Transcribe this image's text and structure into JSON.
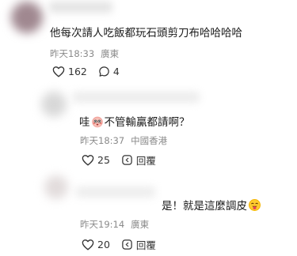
{
  "comments": [
    {
      "text": "他每次請人吃飯都玩石頭剪刀布哈哈哈哈",
      "time": "昨天18:33",
      "location": "廣東",
      "likes": "162",
      "replies": "4"
    },
    {
      "text_before": "哇",
      "text_after": "不管輸贏都請啊？",
      "time": "昨天18:37",
      "location": "中國香港",
      "likes": "25",
      "reply_label": "回覆"
    },
    {
      "text": "是！就是這麼調皮",
      "time": "昨天19:14",
      "location": "廣東",
      "likes": "20",
      "reply_label": "回覆"
    }
  ],
  "icons": {
    "like": "heart-outline-icon",
    "comment": "speech-bubble-icon",
    "reply": "reply-box-icon",
    "emoji_1": "flushed-face-emoji",
    "emoji_2": "tongue-out-face-emoji"
  }
}
